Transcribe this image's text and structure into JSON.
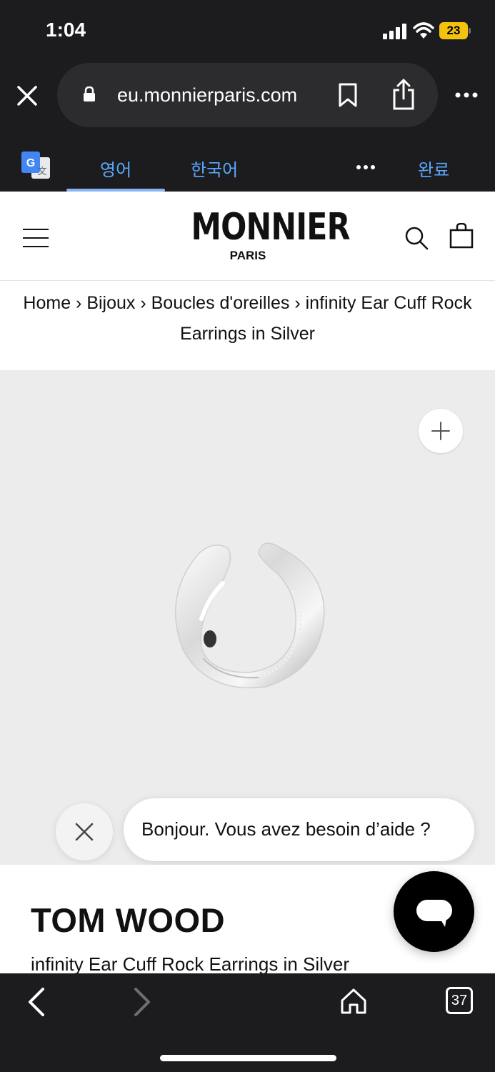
{
  "status_bar": {
    "time": "1:04",
    "battery": "23"
  },
  "browser": {
    "url": "eu.monnierparis.com"
  },
  "translate_bar": {
    "tabs": [
      "영어",
      "한국어"
    ],
    "done_label": "완료"
  },
  "site": {
    "logo_main": "MONNIER",
    "logo_sub": "PARIS"
  },
  "breadcrumb": {
    "text": "Home › Bijoux › Boucles d'oreilles › infinity Ear Cuff Rock Earrings in Silver"
  },
  "chat": {
    "greeting": "Bonjour. Vous avez besoin d’aide ?"
  },
  "product": {
    "brand": "TOM WOOD",
    "name": "infinity Ear Cuff Rock Earrings in Silver"
  },
  "toolbar": {
    "tab_count": "37"
  },
  "colors": {
    "browser_chrome": "#1c1c1e",
    "link_blue": "#5aa8ff",
    "battery_yellow": "#f4c20d",
    "product_bg": "#ececec"
  },
  "icons": [
    "close-icon",
    "lock-icon",
    "bookmark-icon",
    "share-icon",
    "more-icon",
    "google-translate-icon",
    "hamburger-icon",
    "search-icon",
    "bag-icon",
    "plus-icon",
    "chat-icon",
    "back-icon",
    "forward-icon",
    "home-icon"
  ]
}
